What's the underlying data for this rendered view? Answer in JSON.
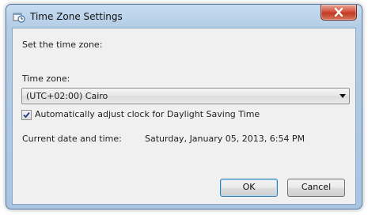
{
  "window": {
    "title": "Time Zone Settings",
    "close_label": "X"
  },
  "heading": "Set the time zone:",
  "timezone": {
    "label": "Time zone:",
    "selected": "(UTC+02:00) Cairo"
  },
  "dst": {
    "checked": true,
    "label": "Automatically adjust clock for Daylight Saving Time"
  },
  "datetime": {
    "label": "Current date and time:",
    "value": "Saturday, January 05, 2013, 6:54 PM"
  },
  "buttons": {
    "ok": "OK",
    "cancel": "Cancel"
  },
  "colors": {
    "frame": "#b4cde6",
    "client": "#f0f0f0",
    "close": "#c23a22",
    "ok_border": "#3c7fb1"
  },
  "icons": {
    "app": "clock-settings-icon",
    "close": "close-icon",
    "dropdown": "chevron-down-icon",
    "check": "checkmark-icon"
  }
}
